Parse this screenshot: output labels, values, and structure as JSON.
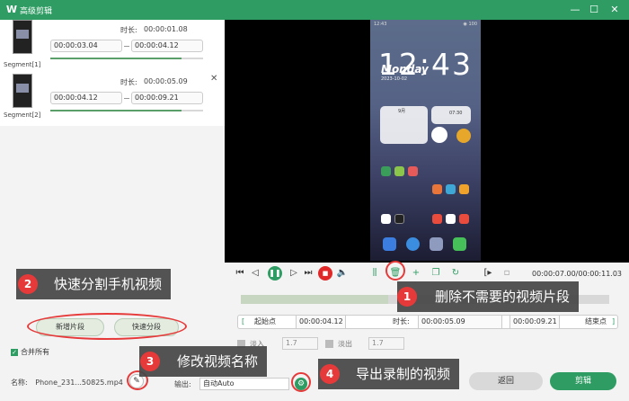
{
  "window": {
    "title": "高级剪辑",
    "logo_glyph": "W",
    "minimize_glyph": "—",
    "maximize_glyph": "☐",
    "close_glyph": "✕"
  },
  "segments": [
    {
      "label": "Segment[1]",
      "duration_label": "时长:",
      "duration": "00:00:01.08",
      "start": "00:00:03.04",
      "end": "00:00:04.12",
      "progress": 0.86
    },
    {
      "label": "Segment[2]",
      "duration_label": "时长:",
      "duration": "00:00:05.09",
      "start": "00:00:04.12",
      "end": "00:00:09.21",
      "progress": 0.86,
      "close_glyph": "✕"
    }
  ],
  "left_panel": {
    "add_segment_button": "新增片段",
    "quick_split_button": "快速分段",
    "merge_all_label": "合并所有",
    "merge_all_checked": true,
    "name_label": "名称:",
    "name_value": "Phone_231...50825.mp4",
    "edit_icon_glyph": "✎"
  },
  "phone_preview": {
    "status_left": "12:43",
    "status_right": "◉ 100",
    "time": "12:43",
    "day": "Monday",
    "date": "2023-10-02",
    "calendar_month": "9月",
    "clock_time": "07:30"
  },
  "playback": {
    "current_time": "00:00:07.00",
    "total_time": "00:00:11.03",
    "separator": "/",
    "track_progress": 0.4
  },
  "trim": {
    "start_button": "起始点",
    "start_value": "00:00:04.12",
    "duration_label": "时长:",
    "duration_value": "00:00:05.09",
    "end_value": "00:00:09.21",
    "end_button": "结束点"
  },
  "fade": {
    "fade_in_label": "淡入",
    "fade_in_value": "1.7",
    "fade_out_label": "淡出",
    "fade_out_value": "1.7"
  },
  "output": {
    "label": "输出:",
    "value": "自动Auto"
  },
  "footer": {
    "back_button": "返回",
    "cut_button": "剪辑"
  },
  "callouts": [
    {
      "number": "1",
      "text": "删除不需要的视频片段"
    },
    {
      "number": "2",
      "text": "快速分割手机视频"
    },
    {
      "number": "3",
      "text": "修改视频名称"
    },
    {
      "number": "4",
      "text": "导出录制的视频"
    }
  ],
  "colors": {
    "brand_green": "#2f9c63",
    "callout_red": "#e63a3a",
    "stop_red": "#e02828"
  }
}
